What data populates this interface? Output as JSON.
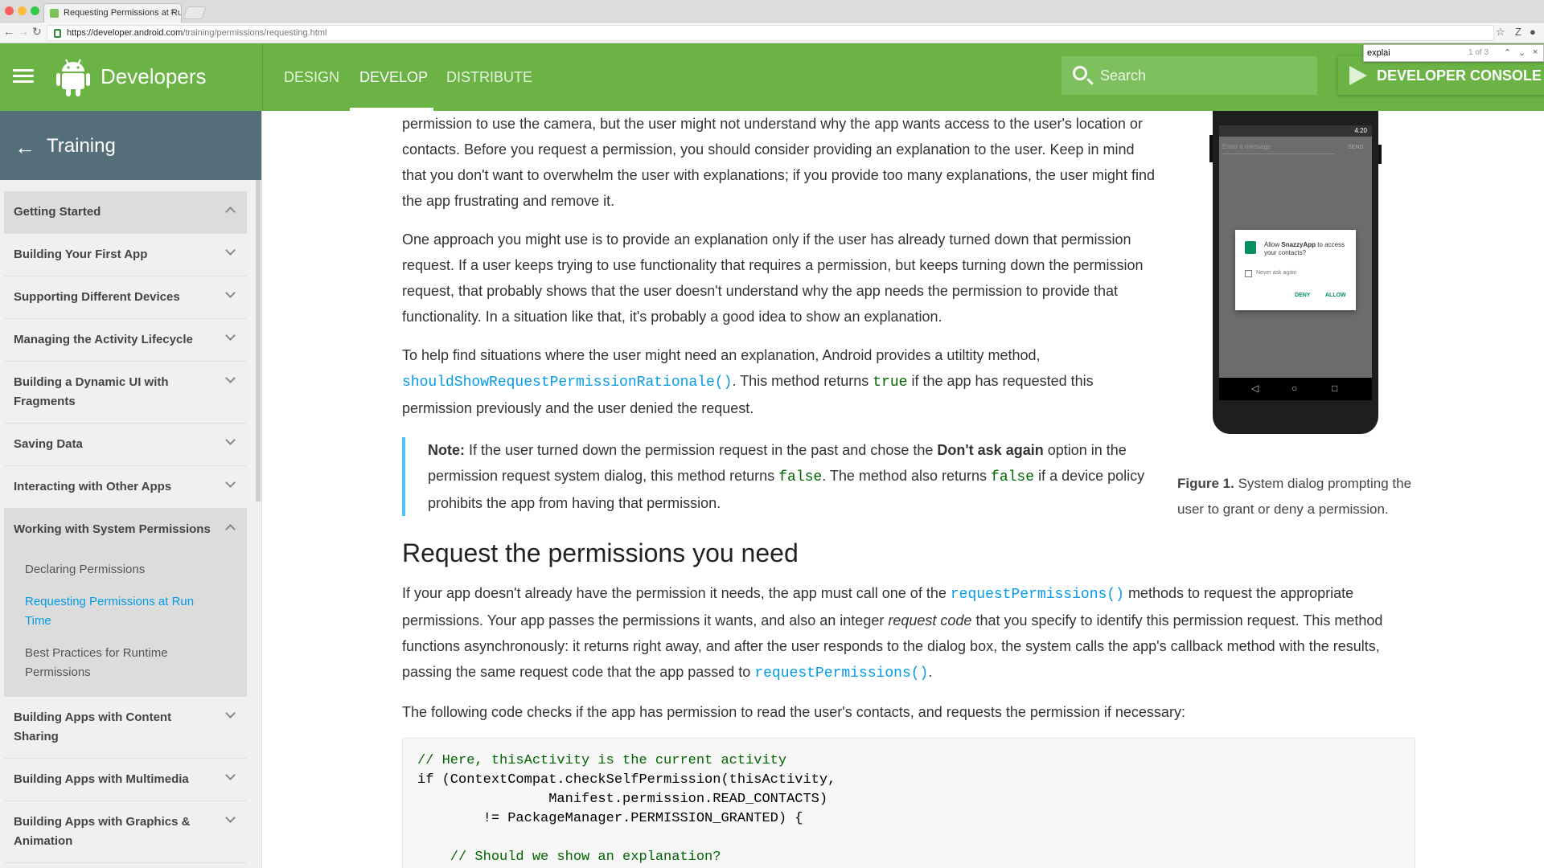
{
  "browser": {
    "tab_title": "Requesting Permissions at Ru",
    "tab_close": "×",
    "url_host": "https://developer.android.com",
    "url_path": "/training/permissions/requesting.html",
    "find": {
      "query": "explai",
      "count": "1 of 3",
      "prev": "⌃",
      "next": "⌄",
      "close": "×"
    }
  },
  "header": {
    "brand": "Developers",
    "nav": [
      "DESIGN",
      "DEVELOP",
      "DISTRIBUTE"
    ],
    "search_placeholder": "Search",
    "console_label": "DEVELOPER CONSOLE"
  },
  "sidebar": {
    "title": "Training",
    "items": [
      {
        "label": "Getting Started"
      },
      {
        "label": "Building Your First App"
      },
      {
        "label": "Supporting Different Devices"
      },
      {
        "label": "Managing the Activity Lifecycle"
      },
      {
        "label": "Building a Dynamic UI with Fragments"
      },
      {
        "label": "Saving Data"
      },
      {
        "label": "Interacting with Other Apps"
      },
      {
        "label": "Working with System Permissions"
      },
      {
        "label": "Building Apps with Content Sharing"
      },
      {
        "label": "Building Apps with Multimedia"
      },
      {
        "label": "Building Apps with Graphics & Animation"
      }
    ],
    "sub_items": [
      "Declaring Permissions",
      "Requesting Permissions at Run Time",
      "Best Practices for Runtime Permissions"
    ]
  },
  "content": {
    "p1": "permission to use the camera, but the user might not understand why the app wants access to the user's location or contacts. Before you request a permission, you should consider providing an explanation to the user. Keep in mind that you don't want to overwhelm the user with explanations; if you provide too many explanations, the user might find the app frustrating and remove it.",
    "p2": "One approach you might use is to provide an explanation only if the user has already turned down that permission request. If a user keeps trying to use functionality that requires a permission, but keeps turning down the permission request, that probably shows that the user doesn't understand why the app needs the permission to provide that functionality. In a situation like that, it's probably a good idea to show an explanation.",
    "p3_a": "To help find situations where the user might need an explanation, Android provides a utiltity method,",
    "p3_api": "shouldShowRequestPermissionRationale()",
    "p3_b": ". This method returns",
    "p3_true": "true",
    "p3_c": "if the app has requested this permission previously and the user denied the request.",
    "note_label": "Note:",
    "note_a": "If the user turned down the permission request in the past and chose the",
    "note_bold": "Don't ask again",
    "note_b": "option in the permission request system dialog, this method returns",
    "note_false1": "false",
    "note_c": ". The method also returns",
    "note_false2": "false",
    "note_d": "if a device policy prohibits the app from having that permission.",
    "h2": "Request the permissions you need",
    "p4_a": "If your app doesn't already have the permission it needs, the app must call one of the",
    "p4_api1": "requestPermissions()",
    "p4_b": "methods to request the appropriate permissions. Your app passes the permissions it wants, and also an integer",
    "p4_em": "request code",
    "p4_c": "that you specify to identify this permission request. This method functions asynchronously: it returns right away, and after the user responds to the dialog box, the system calls the app's callback method with the results, passing the same request code that the app passed to",
    "p4_api2": "requestPermissions()",
    "p4_d": ".",
    "p5": "The following code checks if the app has permission to read the user's contacts, and requests the permission if necessary:",
    "code": [
      "// Here, thisActivity is the current activity",
      "if (ContextCompat.checkSelfPermission(thisActivity,",
      "                Manifest.permission.READ_CONTACTS)",
      "        != PackageManager.PERMISSION_GRANTED) {",
      "",
      "    // Should we show an explanation?"
    ]
  },
  "figure": {
    "status_time": "4:20",
    "msg_placeholder": "Enter a message",
    "send": "SEND",
    "dialog_text_a": "Allow",
    "dialog_app": "SnazzyApp",
    "dialog_text_b": "to access your contacts?",
    "checkbox_label": "Never ask again",
    "deny": "DENY",
    "allow": "ALLOW",
    "nav_back": "◁",
    "nav_home": "○",
    "nav_recent": "□",
    "caption_label": "Figure 1.",
    "caption_text": "System dialog prompting the user to grant or deny a permission."
  },
  "colors": {
    "header_green": "#6ab344",
    "sidebar_head": "#546e7a",
    "link_blue": "#039be5",
    "code_green": "#006400"
  }
}
